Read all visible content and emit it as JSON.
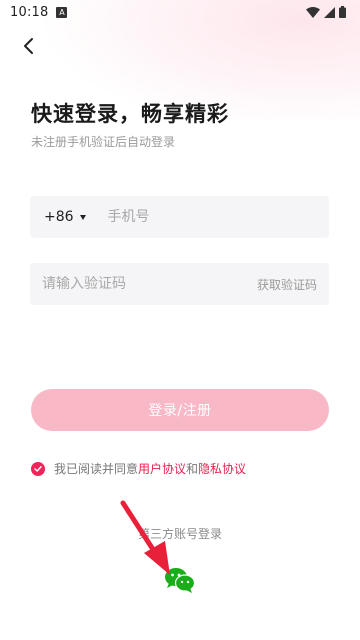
{
  "status_bar": {
    "time": "10:18",
    "notif_letter": "A"
  },
  "header": {
    "title": "快速登录，畅享精彩",
    "subtitle": "未注册手机验证后自动登录"
  },
  "phone": {
    "country_code": "+86",
    "placeholder": "手机号"
  },
  "code": {
    "placeholder": "请输入验证码",
    "get_code_label": "获取验证码"
  },
  "login_button_label": "登录/注册",
  "agreement": {
    "prefix": "我已阅读并同意",
    "user_agreement": "用户协议",
    "and": "和",
    "privacy_policy": "隐私协议"
  },
  "third_party_label": "第三方账号登录",
  "colors": {
    "accent": "#e8204f",
    "button_disabled": "#f9b8c6",
    "field_bg": "#f5f5f7",
    "wechat": "#1aad19",
    "arrow": "#e8203a"
  },
  "icons": [
    "back-arrow-icon",
    "wifi-icon",
    "signal-icon",
    "battery-icon",
    "dropdown-caret-icon",
    "checkmark-icon",
    "wechat-icon",
    "annotation-arrow-icon"
  ]
}
